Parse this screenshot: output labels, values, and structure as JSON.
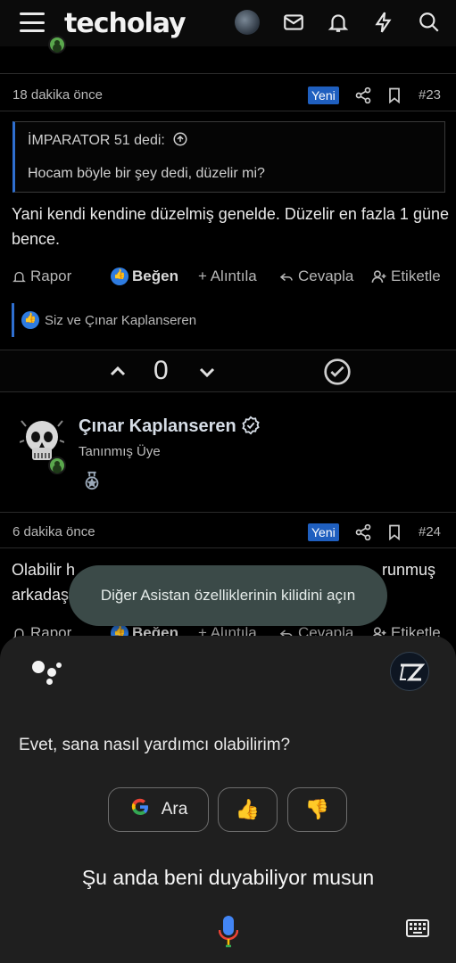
{
  "header": {
    "logo": "techolay",
    "icons": [
      "menu-icon",
      "avatar",
      "mail-icon",
      "bell-icon",
      "bolt-icon",
      "search-icon"
    ]
  },
  "posts": [
    {
      "time": "18 dakika önce",
      "badge": "Yeni",
      "number": "#23",
      "quote": {
        "author": "İMPARATOR 51 dedi:",
        "text": "Hocam böyle bir şey dedi, düzelir mi?"
      },
      "body": "Yani kendi kendine düzelmiş genelde. Düzelir en fazla 1 güne bence.",
      "actions": {
        "report": "Rapor",
        "like": "Beğen",
        "quote": "+ Alıntıla",
        "reply": "Cevapla",
        "tag": "Etiketle"
      },
      "reactions": "Siz ve Çınar Kaplanseren",
      "vote_count": "0"
    },
    {
      "author": "Çınar Kaplanseren",
      "author_title": "Tanınmış Üye",
      "time": "6 dakika önce",
      "badge": "Yeni",
      "number": "#24",
      "body_line1_start": "Olabilir h",
      "body_line1_end": "runmuş",
      "body_line2_start": "arkadaş",
      "actions": {
        "report": "Rapor",
        "like": "Beğen",
        "quote": "+ Alıntıla",
        "reply": "Cevapla",
        "tag": "Etiketle"
      }
    }
  ],
  "toast": "Diğer Asistan özelliklerinin kilidini açın",
  "assistant": {
    "question": "Evet, sana nasıl yardımcı olabilirim?",
    "search_chip": "Ara",
    "google_letter": "G",
    "thumbs_up": "👍",
    "thumbs_down": "👎",
    "heard_text": "Şu anda beni duyabiliyor musun"
  },
  "colors": {
    "accent_blue": "#2f6fd0",
    "badge_blue": "#1f5fbf",
    "online_green": "#5aa84d",
    "assistant_bg": "#1f1f1f",
    "toast_bg": "#3b4a48"
  }
}
